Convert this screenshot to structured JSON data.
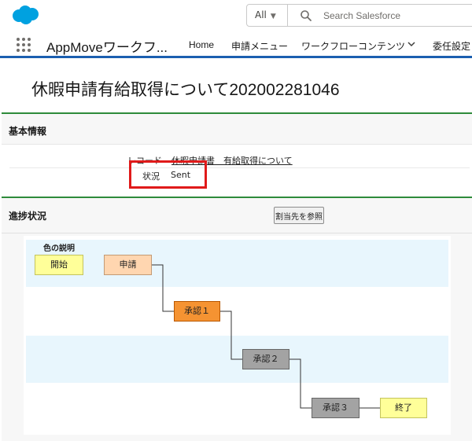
{
  "header": {
    "search_scope": "All",
    "search_placeholder": "Search Salesforce"
  },
  "nav": {
    "app_name": "AppMoveワークフ...",
    "items": [
      "Home",
      "申請メニュー",
      "ワークフローコンテンツ",
      "委任設定"
    ]
  },
  "page": {
    "title": "休暇申請有給取得について202002281046"
  },
  "basic_info": {
    "section_title": "基本情報",
    "record_label": "レコード",
    "record_link": "休暇申請書　有給取得について",
    "status_label": "状況",
    "status_value": "Sent"
  },
  "progress": {
    "section_title": "進捗状況",
    "assign_button": "割当先を参照",
    "legend_title": "色の説明",
    "nodes": [
      {
        "label": "開始",
        "color": "#ffff99"
      },
      {
        "label": "申請",
        "color": "#ffd6b0"
      },
      {
        "label": "承認１",
        "color": "#f59332"
      },
      {
        "label": "承認２",
        "color": "#a3a3a3"
      },
      {
        "label": "承認３",
        "color": "#a3a3a3"
      },
      {
        "label": "終了",
        "color": "#ffff99"
      }
    ]
  },
  "colors": {
    "brand_blue": "#1b5fb0",
    "section_green": "#2e8b3a",
    "highlight_red": "#e01a1a",
    "salesforce_cloud": "#00a1e0",
    "band_blue": "#e8f6fd"
  }
}
